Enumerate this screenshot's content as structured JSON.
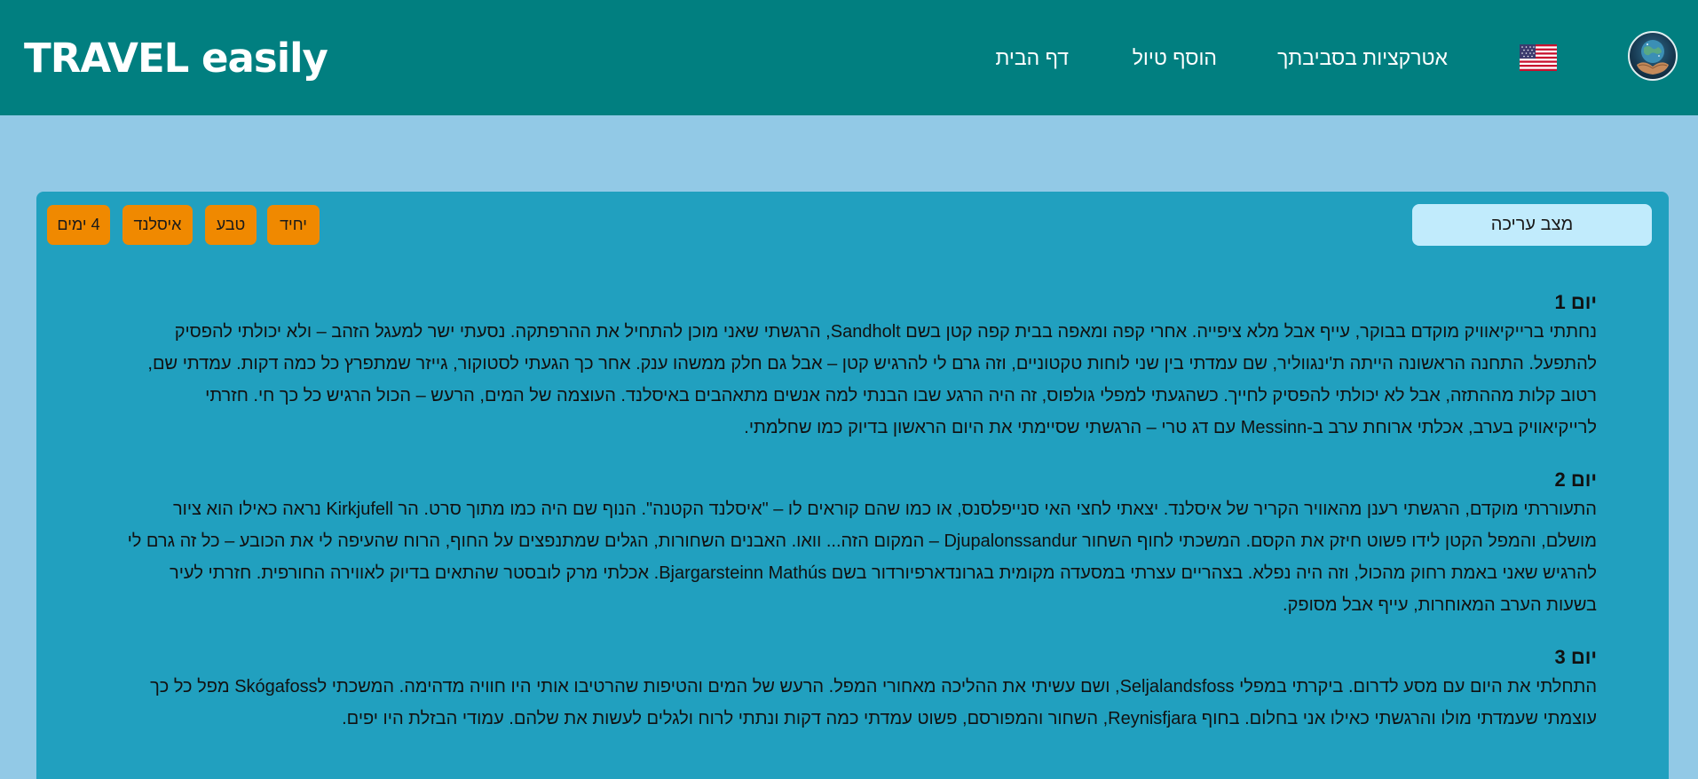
{
  "header": {
    "brand": "TRAVEL easily",
    "nav": {
      "home": "דף הבית",
      "add_trip": "הוסף טיול",
      "attractions": "אטרקציות בסביבתך"
    },
    "language_icon": "us-flag-icon",
    "avatar_icon": "globe-in-hands-avatar"
  },
  "trip": {
    "edit_mode_label": "מצב עריכה",
    "tags": [
      "4 ימים",
      "איסלנד",
      "טבע",
      "יחיד"
    ],
    "days": [
      {
        "title": "יום 1",
        "text": "נחתתי ברייקיאוויק מוקדם בבוקר, עייף אבל מלא ציפייה. אחרי קפה ומאפה בבית קפה קטן בשם Sandholt, הרגשתי שאני מוכן להתחיל את ההרפתקה. נסעתי ישר למעגל הזהב – ולא יכולתי להפסיק להתפעל. התחנה הראשונה הייתה ת'ינגווליר, שם עמדתי בין שני לוחות טקטוניים, וזה גרם לי להרגיש קטן – אבל גם חלק ממשהו ענק. אחר כך הגעתי לסטוקור, גייזר שמתפרץ כל כמה דקות. עמדתי שם, רטוב קלות מההתזה, אבל לא יכולתי להפסיק לחייך. כשהגעתי למפלי גולפוס, זה היה הרגע שבו הבנתי למה אנשים מתאהבים באיסלנד. העוצמה של המים, הרעש – הכול הרגיש כל כך חי. חזרתי לרייקיאוויק בערב, אכלתי ארוחת ערב ב-Messinn עם דג טרי – הרגשתי שסיימתי את היום הראשון בדיוק כמו שחלמתי."
      },
      {
        "title": "יום 2",
        "text": "התעוררתי מוקדם, הרגשתי רענן מהאוויר הקריר של איסלנד. יצאתי לחצי האי סנייפלסנס, או כמו שהם קוראים לו – \"איסלנד הקטנה\". הנוף שם היה כמו מתוך סרט. הר Kirkjufell נראה כאילו הוא ציור מושלם, והמפל הקטן לידו פשוט חיזק את הקסם. המשכתי לחוף השחור Djupalonssandur – המקום הזה... וואו. האבנים השחורות, הגלים שמתנפצים על החוף, הרוח שהעיפה לי את הכובע – כל זה גרם לי להרגיש שאני באמת רחוק מהכול, וזה היה נפלא. בצהריים עצרתי במסעדה מקומית בגרונדארפיורדור בשם Bjargarsteinn Mathús. אכלתי מרק לובסטר שהתאים בדיוק לאווירה החורפית. חזרתי לעיר בשעות הערב המאוחרות, עייף אבל מסופק."
      },
      {
        "title": "יום 3",
        "text": "התחלתי את היום עם מסע לדרום. ביקרתי במפלי Seljalandsfoss, ושם עשיתי את ההליכה מאחורי המפל. הרעש של המים והטיפות שהרטיבו אותי היו חוויה מדהימה. המשכתי לSkógafoss מפל כל כך עוצמתי שעמדתי מולו והרגשתי כאילו אני בחלום. בחוף Reynisfjara, השחור והמפורסם, פשוט עמדתי כמה דקות ונתתי לרוח ולגלים לעשות את שלהם. עמודי הבזלת היו יפים."
      }
    ]
  }
}
